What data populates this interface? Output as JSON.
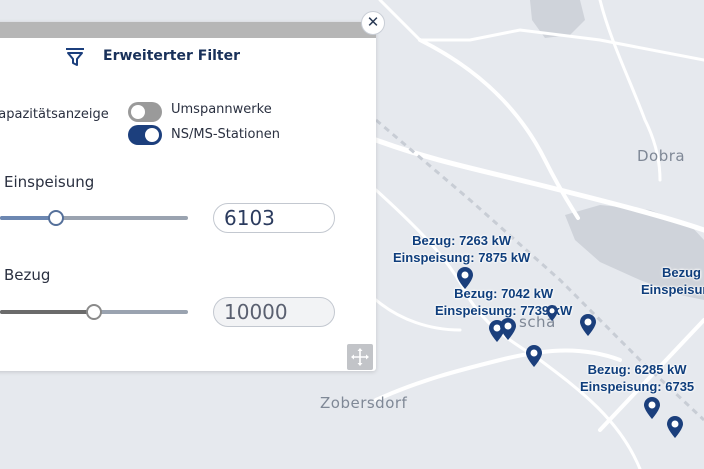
{
  "map": {
    "places": [
      "Dobra",
      "Zobersdorf",
      "scha"
    ],
    "markers": [
      {
        "bezug": "Bezug: 7263 kW",
        "einspeisung": "Einspeisung: 7875 kW"
      },
      {
        "bezug": "Bezug: 7042 kW",
        "einspeisung": "Einspeisung: 7739 kW"
      },
      {
        "bezug": "Bezug: 6285 kW",
        "einspeisung": "Einspeisung: 6735"
      },
      {
        "bezug": "Bezug",
        "einspeisung": "Einspeisun"
      }
    ],
    "colors": {
      "background": "#e6e9ee",
      "roads": "#ffffff",
      "water": "#cfd3da",
      "pin": "#1b3f7c"
    }
  },
  "filter_panel": {
    "title": "Erweiterter Filter",
    "close_symbol": "✕",
    "capacity_label": "Kapazitätsanzeige",
    "toggles": [
      {
        "label": "Umspannwerke",
        "on": false
      },
      {
        "label": "NS/MS-Stationen",
        "on": true
      }
    ],
    "einspeisung": {
      "label": "Einspeisung",
      "value": "6103",
      "slider_fraction": 0.3
    },
    "bezug": {
      "label": "Bezug",
      "value": "10000",
      "slider_fraction": 0.5
    },
    "move_icon": "move-icon"
  }
}
